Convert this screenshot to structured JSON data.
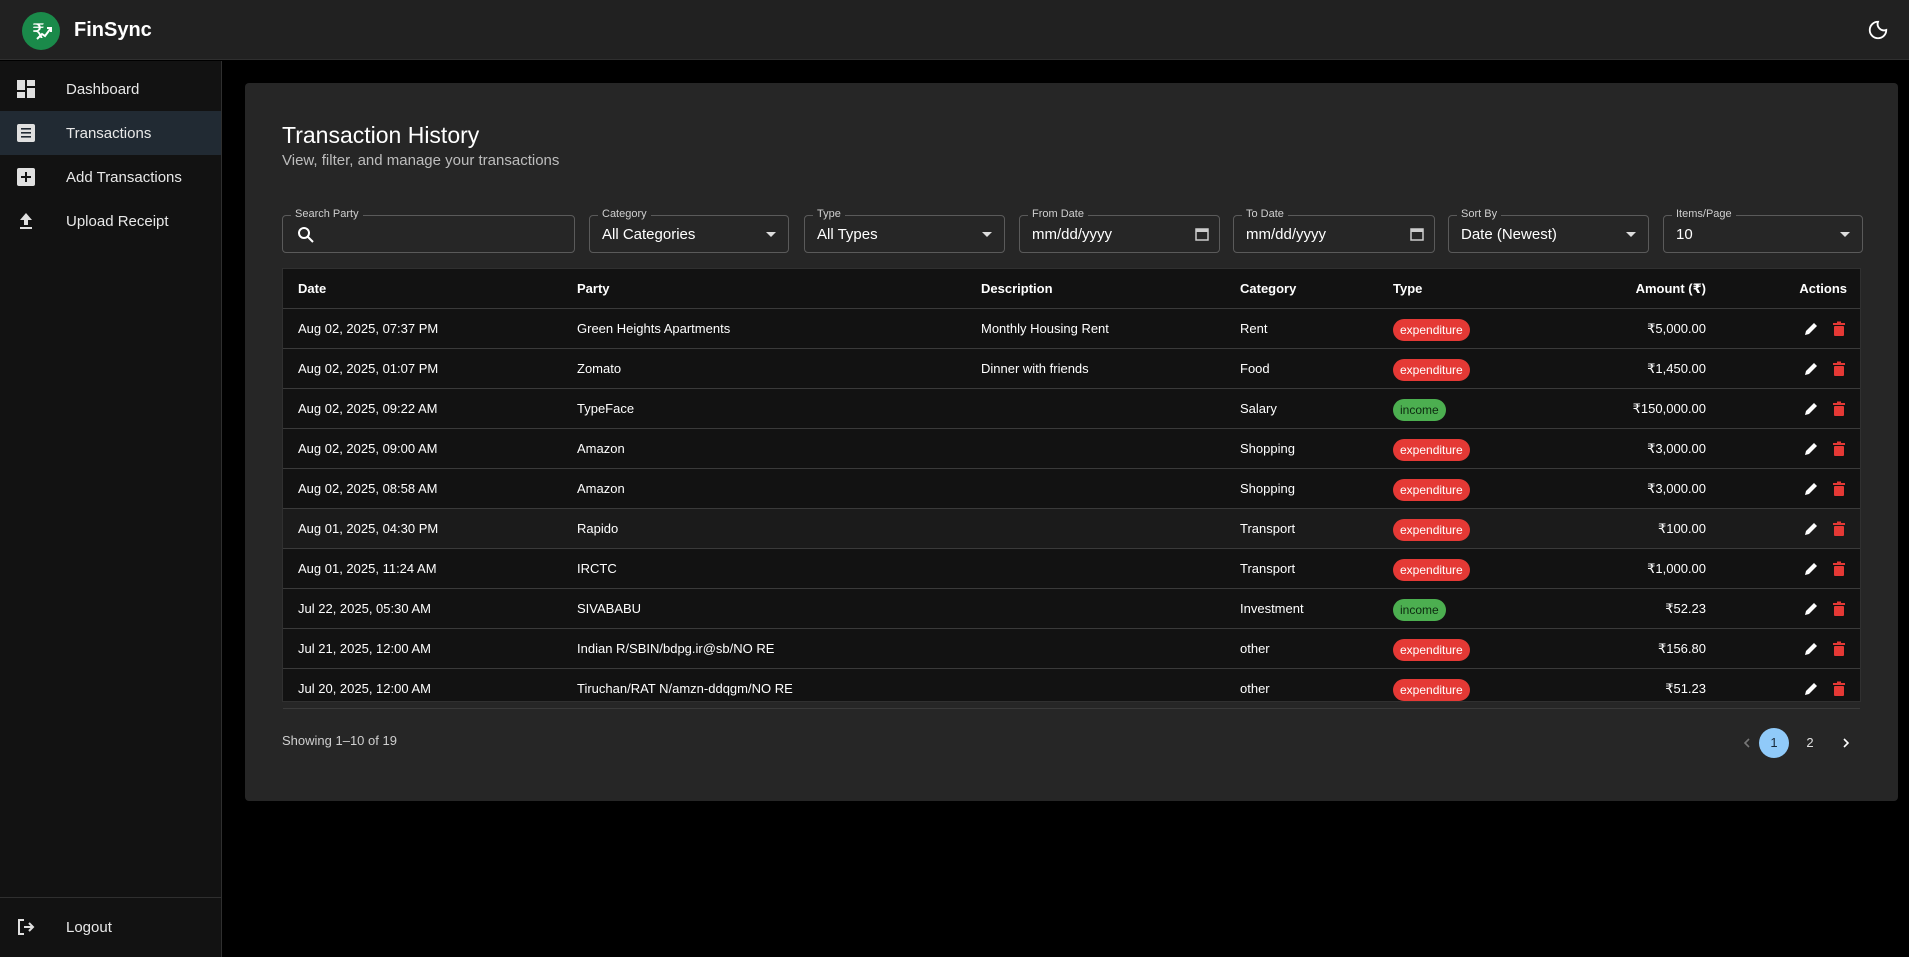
{
  "app": {
    "name": "FinSync"
  },
  "sidebar": {
    "items": [
      {
        "label": "Dashboard",
        "icon": "dashboard-icon"
      },
      {
        "label": "Transactions",
        "icon": "list-icon",
        "active": true
      },
      {
        "label": "Add Transactions",
        "icon": "add-box-icon"
      },
      {
        "label": "Upload Receipt",
        "icon": "upload-icon"
      }
    ],
    "logout": {
      "label": "Logout",
      "icon": "logout-icon"
    }
  },
  "page": {
    "title": "Transaction History",
    "subtitle": "View, filter, and manage your transactions"
  },
  "filters": {
    "search": {
      "label": "Search Party",
      "value": ""
    },
    "category": {
      "label": "Category",
      "value": "All Categories"
    },
    "type": {
      "label": "Type",
      "value": "All Types"
    },
    "from_date": {
      "label": "From Date",
      "value": "mm/dd/yyyy"
    },
    "to_date": {
      "label": "To Date",
      "value": "mm/dd/yyyy"
    },
    "sort_by": {
      "label": "Sort By",
      "value": "Date (Newest)"
    },
    "items_per_page": {
      "label": "Items/Page",
      "value": "10"
    }
  },
  "table": {
    "headers": {
      "date": "Date",
      "party": "Party",
      "description": "Description",
      "category": "Category",
      "type": "Type",
      "amount": "Amount (₹)",
      "actions": "Actions"
    },
    "rows": [
      {
        "date": "Aug 02, 2025, 07:37 PM",
        "party": "Green Heights Apartments",
        "description": "Monthly Housing Rent",
        "category": "Rent",
        "type": "expenditure",
        "amount": "₹5,000.00"
      },
      {
        "date": "Aug 02, 2025, 01:07 PM",
        "party": "Zomato",
        "description": "Dinner with friends",
        "category": "Food",
        "type": "expenditure",
        "amount": "₹1,450.00"
      },
      {
        "date": "Aug 02, 2025, 09:22 AM",
        "party": "TypeFace",
        "description": "",
        "category": "Salary",
        "type": "income",
        "amount": "₹150,000.00"
      },
      {
        "date": "Aug 02, 2025, 09:00 AM",
        "party": "Amazon",
        "description": "",
        "category": "Shopping",
        "type": "expenditure",
        "amount": "₹3,000.00"
      },
      {
        "date": "Aug 02, 2025, 08:58 AM",
        "party": "Amazon",
        "description": "",
        "category": "Shopping",
        "type": "expenditure",
        "amount": "₹3,000.00"
      },
      {
        "date": "Aug 01, 2025, 04:30 PM",
        "party": "Rapido",
        "description": "",
        "category": "Transport",
        "type": "expenditure",
        "amount": "₹100.00"
      },
      {
        "date": "Aug 01, 2025, 11:24 AM",
        "party": "IRCTC",
        "description": "",
        "category": "Transport",
        "type": "expenditure",
        "amount": "₹1,000.00"
      },
      {
        "date": "Jul 22, 2025, 05:30 AM",
        "party": "SIVABABU",
        "description": "",
        "category": "Investment",
        "type": "income",
        "amount": "₹52.23"
      },
      {
        "date": "Jul 21, 2025, 12:00 AM",
        "party": "Indian R/SBIN/bdpg.ir@sb/NO RE",
        "description": "",
        "category": "other",
        "type": "expenditure",
        "amount": "₹156.80"
      },
      {
        "date": "Jul 20, 2025, 12:00 AM",
        "party": "Tiruchan/RAT N/amzn-ddqgm/NO RE",
        "description": "",
        "category": "other",
        "type": "expenditure",
        "amount": "₹51.23"
      }
    ]
  },
  "pagination": {
    "showing": "Showing 1–10 of 19",
    "pages": [
      "1",
      "2"
    ],
    "current": "1"
  },
  "colors": {
    "accent": "#90caf9",
    "expenditure": "#e53935",
    "income": "#4caf50",
    "logo": "#1a8a4a"
  }
}
